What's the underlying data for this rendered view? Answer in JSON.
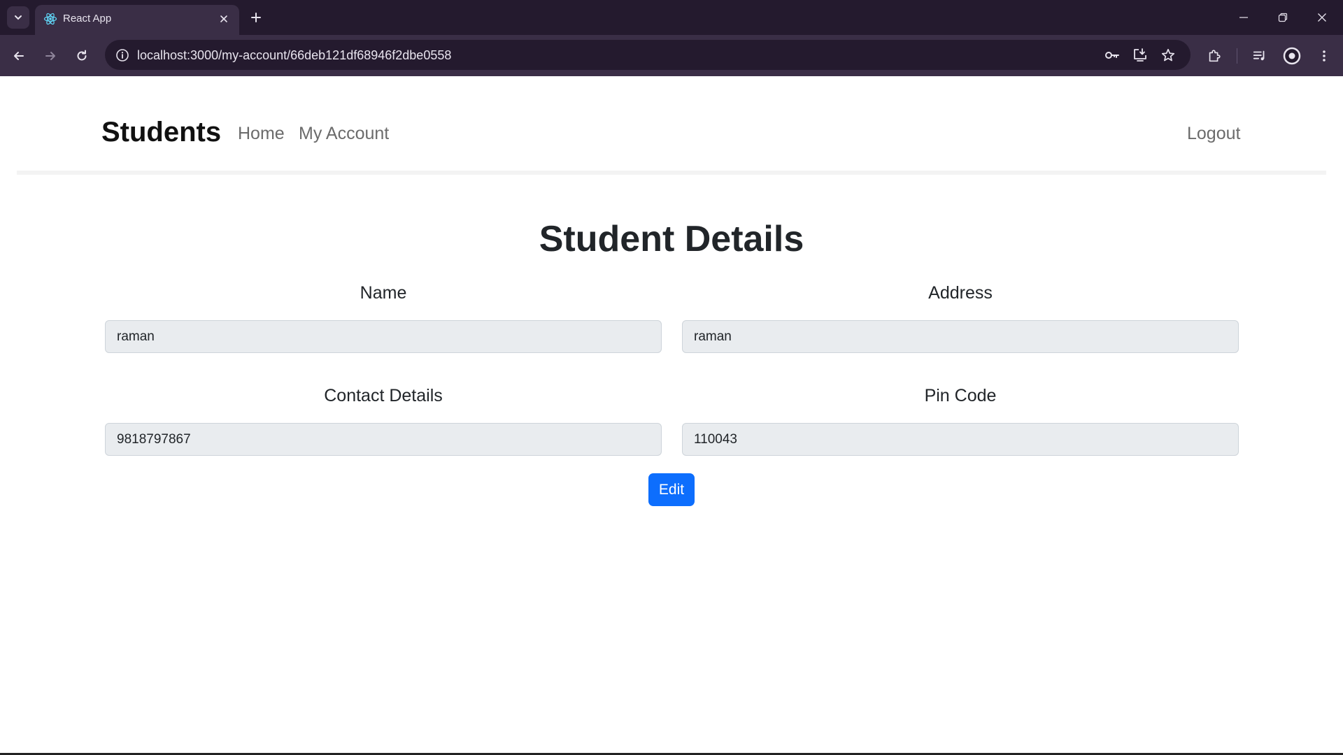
{
  "browser": {
    "tab_title": "React App",
    "url": "localhost:3000/my-account/66deb121df68946f2dbe0558",
    "colors": {
      "frame": "#241a2e",
      "toolbar": "#3a2e46",
      "text": "#e8e4ee"
    }
  },
  "navbar": {
    "brand": "Students",
    "links": [
      "Home",
      "My Account"
    ],
    "logout": "Logout"
  },
  "page": {
    "title": "Student Details",
    "fields": [
      {
        "label": "Name",
        "value": "raman"
      },
      {
        "label": "Address",
        "value": "raman"
      },
      {
        "label": "Contact Details",
        "value": "9818797867"
      },
      {
        "label": "Pin Code",
        "value": "110043"
      }
    ],
    "edit_label": "Edit",
    "colors": {
      "primary": "#0d6efd",
      "input_bg": "#e9ecef"
    }
  }
}
